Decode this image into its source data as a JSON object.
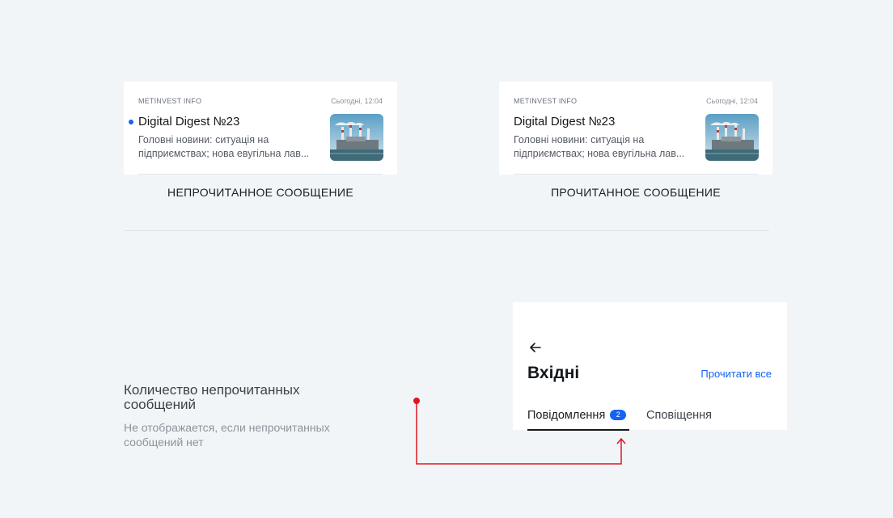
{
  "unread_card": {
    "sender": "METINVEST INFO",
    "time": "Сьогодні, 12:04",
    "title": "Digital Digest №23",
    "preview_line1": "Головні новини: ситуація на",
    "preview_line2": "підприємствах; нова евугільна лав...",
    "thumbnail_icon": "industrial-plant-photo",
    "caption": "НЕПРОЧИТАННОЕ СООБЩЕНИЕ"
  },
  "read_card": {
    "sender": "METINVEST INFO",
    "time": "Сьогодні, 12:04",
    "title": "Digital Digest №23",
    "preview_line1": "Головні новини: ситуація на",
    "preview_line2": "підприємствах; нова евугільна лав...",
    "thumbnail_icon": "industrial-plant-photo",
    "caption": "ПРОЧИТАННОЕ СООБЩЕНИЕ"
  },
  "note": {
    "title": "Количество непрочитанных сообщений",
    "subtitle": "Не отображается, если непрочитанных сообщений нет"
  },
  "inbox_panel": {
    "back_icon": "arrow-left-icon",
    "heading": "Вхідні",
    "read_all": "Прочитати все",
    "tabs": [
      {
        "label": "Повідомлення",
        "badge": "2",
        "active": true
      },
      {
        "label": "Сповіщення",
        "active": false
      }
    ]
  },
  "colors": {
    "accent": "#1463f3",
    "annotation": "#e0161e",
    "background": "#f2f5f8"
  }
}
